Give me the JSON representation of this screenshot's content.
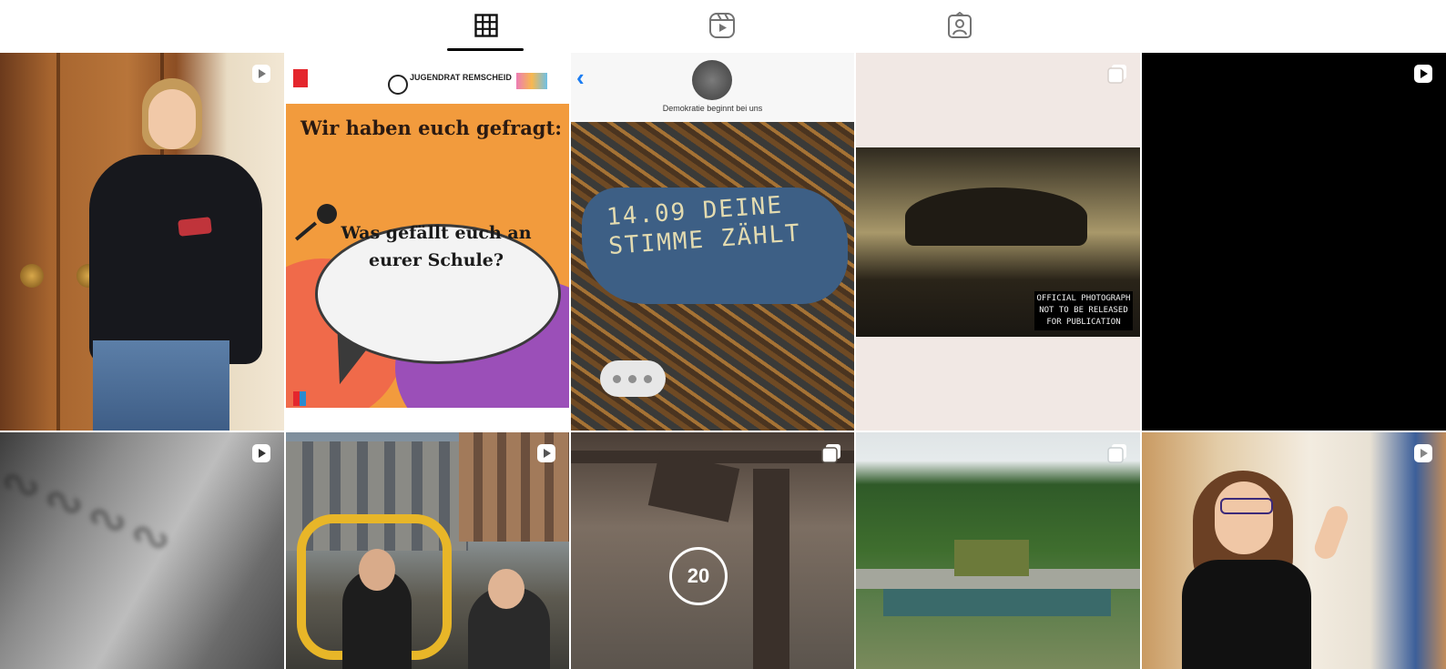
{
  "tabs": [
    {
      "name": "posts",
      "icon": "grid-icon",
      "active": true
    },
    {
      "name": "reels",
      "icon": "reels-icon",
      "active": false
    },
    {
      "name": "tagged",
      "icon": "tagged-user-icon",
      "active": false
    }
  ],
  "posts": {
    "t2": {
      "header_org": "JUGENDRAT REMSCHEID",
      "heading": "Wir haben euch gefragt:",
      "question": "Was gefällt euch an eurer Schule?"
    },
    "t3": {
      "chat_title": "Demokratie beginnt bei uns",
      "graffiti": "14.09 DEINE STIMME ZÄHLT"
    },
    "t4": {
      "stamp": "OFFICIAL PHOTOGRAPH NOT TO BE RELEASED FOR PUBLICATION"
    },
    "t8": {
      "overlay_number": "20"
    }
  },
  "badges": {
    "reel": "reel-badge-icon",
    "carousel": "carousel-badge-icon"
  },
  "colors": {
    "accent": "#000000",
    "link_blue": "#1b7cf2",
    "poster_orange": "#f29b3d",
    "poster_purple": "#9b4fb8"
  }
}
